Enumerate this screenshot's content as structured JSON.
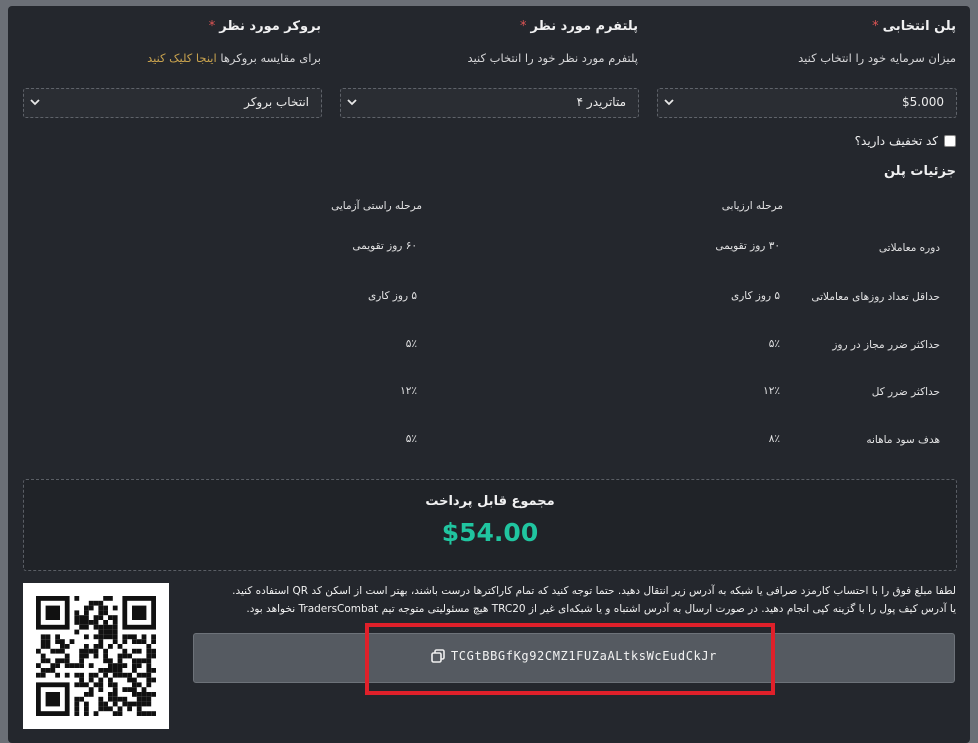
{
  "form": {
    "plan": {
      "label": "پلن انتخابی",
      "required": "*",
      "hint": "میزان سرمایه خود را انتخاب کنید",
      "selected": "$5.000"
    },
    "platform": {
      "label": "پلتفرم مورد نظر",
      "required": "*",
      "hint": "پلتفرم مورد نظر خود را انتخاب کنید",
      "selected": "متاتریدر ۴"
    },
    "broker": {
      "label": "بروکر مورد نظر",
      "required": "*",
      "hint_text": "برای مقایسه بروکرها",
      "hint_link": "اینجا کلیک کنید",
      "selected": "انتخاب بروکر"
    },
    "discount_label": "کد تخفیف دارید؟"
  },
  "plan_details": {
    "title": "جزئیات پلن",
    "phases": [
      "مرحله ارزیابی",
      "مرحله راستی آزمایی"
    ],
    "rows": [
      {
        "label": "دوره معاملاتی",
        "values": [
          "۳۰ روز تقویمی",
          "۶۰ روز تقویمی"
        ]
      },
      {
        "label": "حداقل تعداد روزهای معاملاتی",
        "values": [
          "۵ روز کاری",
          "۵ روز کاری"
        ]
      },
      {
        "label": "حداکثر ضرر مجاز در روز",
        "values": [
          "۵٪",
          "۵٪"
        ]
      },
      {
        "label": "حداکثر ضرر کل",
        "values": [
          "۱۲٪",
          "۱۲٪"
        ]
      },
      {
        "label": "هدف سود ماهانه",
        "values": [
          "۸٪",
          "۵٪"
        ]
      }
    ]
  },
  "payment": {
    "total_label": "مجموع قابل پرداخت",
    "total_value": "$54.00",
    "instructions": "لطفا مبلغ فوق را با احتساب کارمزد صرافی یا شبکه به آدرس زیر انتقال دهید. حتما توجه کنید که تمام کاراکترها درست باشند، بهتر است از اسکن کد QR استفاده کنید. یا آدرس کیف پول را با گزینه کپی انجام دهید. در صورت ارسال به آدرس اشتباه و یا شبکه‌ای غیر از TRC20 هیچ مسئولیتی متوجه تیم TradersCombat نخواهد بود.",
    "wallet_address": "TCGtBBGfKg92CMZ1FUZaALtksWcEudCkJr",
    "copy_icon": "copy-icon"
  },
  "colors": {
    "accent": "#20c5a0",
    "required": "#e05555",
    "link": "#c8a24e",
    "highlight": "#e0202a",
    "panel": "#24272d"
  }
}
